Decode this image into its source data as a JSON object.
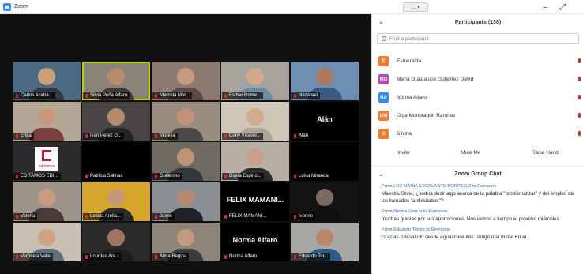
{
  "window": {
    "title": "Zoom",
    "view_label": "::: ▾",
    "minimize": "–",
    "restore": "⤢"
  },
  "gallery": [
    {
      "name": "Carlos Aceba...",
      "kind": "video",
      "bg": "#4a6b82",
      "skin": "#c9a07a",
      "shirt": "#2f3a44"
    },
    {
      "name": "Silvia Peña Alfaro",
      "kind": "video",
      "bg": "#8a8377",
      "skin": "#b58c6e",
      "shirt": "#3f3b38",
      "active": true
    },
    {
      "name": "Marcela Mor...",
      "kind": "video",
      "bg": "#8c7a72",
      "skin": "#c49b80",
      "shirt": "#5d4a46"
    },
    {
      "name": "Esther Rome...",
      "kind": "video",
      "bg": "#a5a39c",
      "skin": "#d1a98b",
      "shirt": "#6b8aa3"
    },
    {
      "name": "Nazareel",
      "kind": "video",
      "bg": "#6e8fb2",
      "skin": "#a97b5c",
      "shirt": "#3d5a80"
    },
    {
      "name": "Erika",
      "kind": "video",
      "bg": "#b4a796",
      "skin": "#c9987a",
      "shirt": "#7a3e3e"
    },
    {
      "name": "Iván Pérez G...",
      "kind": "video",
      "bg": "#4a4545",
      "skin": "#b88a6c",
      "shirt": "#202225"
    },
    {
      "name": "Morelia",
      "kind": "video",
      "bg": "#9a8d80",
      "skin": "#c09378",
      "shirt": "#4c4a48"
    },
    {
      "name": "Cony Villaver...",
      "kind": "video",
      "bg": "#cfc6b8",
      "skin": "#d3ab8c",
      "shirt": "#b0a498"
    },
    {
      "name": "Alán",
      "kind": "name",
      "big": "Alán"
    },
    {
      "name": "EDITAMOS EDI...",
      "kind": "logo",
      "logo_text": "editamos"
    },
    {
      "name": "Patricia Salinas",
      "kind": "black"
    },
    {
      "name": "Guillermo",
      "kind": "video",
      "bg": "#6f6a62",
      "skin": "#bf9175",
      "shirt": "#34383d"
    },
    {
      "name": "Diana Espino...",
      "kind": "video",
      "bg": "#b8afa2",
      "skin": "#caa08a",
      "shirt": "#2b2b2b"
    },
    {
      "name": "Luisa Miranda",
      "kind": "black"
    },
    {
      "name": "Valeria",
      "kind": "video",
      "bg": "#9e948a",
      "skin": "#c99b7e",
      "shirt": "#4a3b3a"
    },
    {
      "name": "Leticia Arella...",
      "kind": "video",
      "bg": "#d7a62c",
      "skin": "#c4967a",
      "shirt": "#2a2a2a"
    },
    {
      "name": "Jaime",
      "kind": "video",
      "bg": "#8a8f94",
      "skin": "#b58a6e",
      "shirt": "#1f2226"
    },
    {
      "name": "FELIX MAMANI...",
      "kind": "name",
      "big": "FELIX MAMANI..."
    },
    {
      "name": "Ivonne",
      "kind": "video",
      "bg": "#141414",
      "skin": "#7d6a5f",
      "shirt": "#101010"
    },
    {
      "name": "Verónica Valle",
      "kind": "video",
      "bg": "#c9c0b3",
      "skin": "#cfa386",
      "shirt": "#5e6f7d"
    },
    {
      "name": "Lourdes Are...",
      "kind": "video",
      "bg": "#2a2a2a",
      "skin": "#9c7660",
      "shirt": "#1e1e1e"
    },
    {
      "name": "Alma Regina",
      "kind": "video",
      "bg": "#8f8479",
      "skin": "#c29a80",
      "shirt": "#3c3c3c"
    },
    {
      "name": "Norma Alfaro",
      "kind": "name",
      "big": "Norma Alfaro"
    },
    {
      "name": "Eduardo Tor...",
      "kind": "video",
      "bg": "#a7a8a4",
      "skin": "#b9876a",
      "shirt": "#2e5d87"
    }
  ],
  "participants": {
    "title": "Participants (138)",
    "search_placeholder": "Find a participant",
    "list": [
      {
        "initials": "E",
        "name": "Esmeralda",
        "color": "#f07d2a"
      },
      {
        "initials": "MG",
        "name": "María Guadalupe Gutiérrez David",
        "color": "#b34bb4"
      },
      {
        "initials": "NA",
        "name": "Norma Alfaro",
        "color": "#2d8cff"
      },
      {
        "initials": "OM",
        "name": "Olga Mondragón Ramírez",
        "color": "#f07d2a"
      },
      {
        "initials": "S",
        "name": "Silvina",
        "color": "#f07d2a"
      }
    ],
    "invite": "Invite",
    "mute_me": "Mute Me",
    "raise_hand": "Raise Hand"
  },
  "chat": {
    "title": "Zoom Group Chat",
    "messages": [
      {
        "from_prefix": "From ",
        "sender": "LUZ MARIA ESCALANTE BORREGO",
        "to": " to Everyone",
        "text": "Maestra Silvia, ¿podría decir algo acerca de la palabra \"problematizar\" y del empleo de los llamados \"archisílabos\"?"
      },
      {
        "from_prefix": "From ",
        "sender": "Norma Garcia",
        "to": " to Everyone",
        "text": "muchas gracias por sus aportaciones. Nos vemos a tiempo el próximo miércoles"
      },
      {
        "from_prefix": "From ",
        "sender": "Eduardo Torres",
        "to": " to Everyone",
        "text": "Gracias. Un saludo desde Aguascalientes. Tengo una duda! En el"
      }
    ]
  }
}
